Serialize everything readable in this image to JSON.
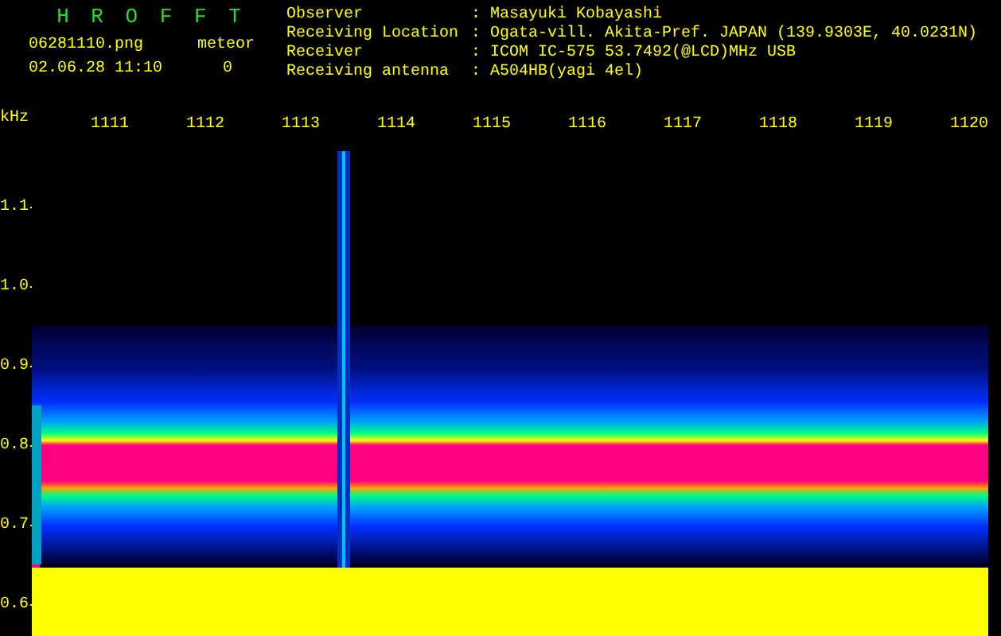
{
  "header": {
    "title": "H R O F F T",
    "filename": "06281110.png",
    "datetime": "02.06.28 11:10",
    "meteor_label": "meteor",
    "meteor_count": "0",
    "info": [
      {
        "label": "Observer",
        "separator": ":",
        "value": "Masayuki Kobayashi"
      },
      {
        "label": "Receiving Location",
        "separator": ":",
        "value": "Ogata-vill. Akita-Pref. JAPAN (139.9303E, 40.0231N)"
      },
      {
        "label": "Receiver",
        "separator": ":",
        "value": "ICOM IC-575 53.7492(@LCD)MHz USB"
      },
      {
        "label": "Receiving antenna",
        "separator": ":",
        "value": "A504HB(yagi 4el)"
      }
    ]
  },
  "axis": {
    "unit": "kHz",
    "x_labels": [
      "1111",
      "1112",
      "1113",
      "1114",
      "1115",
      "1116",
      "1117",
      "1118",
      "1119",
      "1120"
    ],
    "y_labels": [
      "1.1",
      "1.0",
      "0.9",
      "0.8",
      "0.7",
      "0.6"
    ]
  }
}
